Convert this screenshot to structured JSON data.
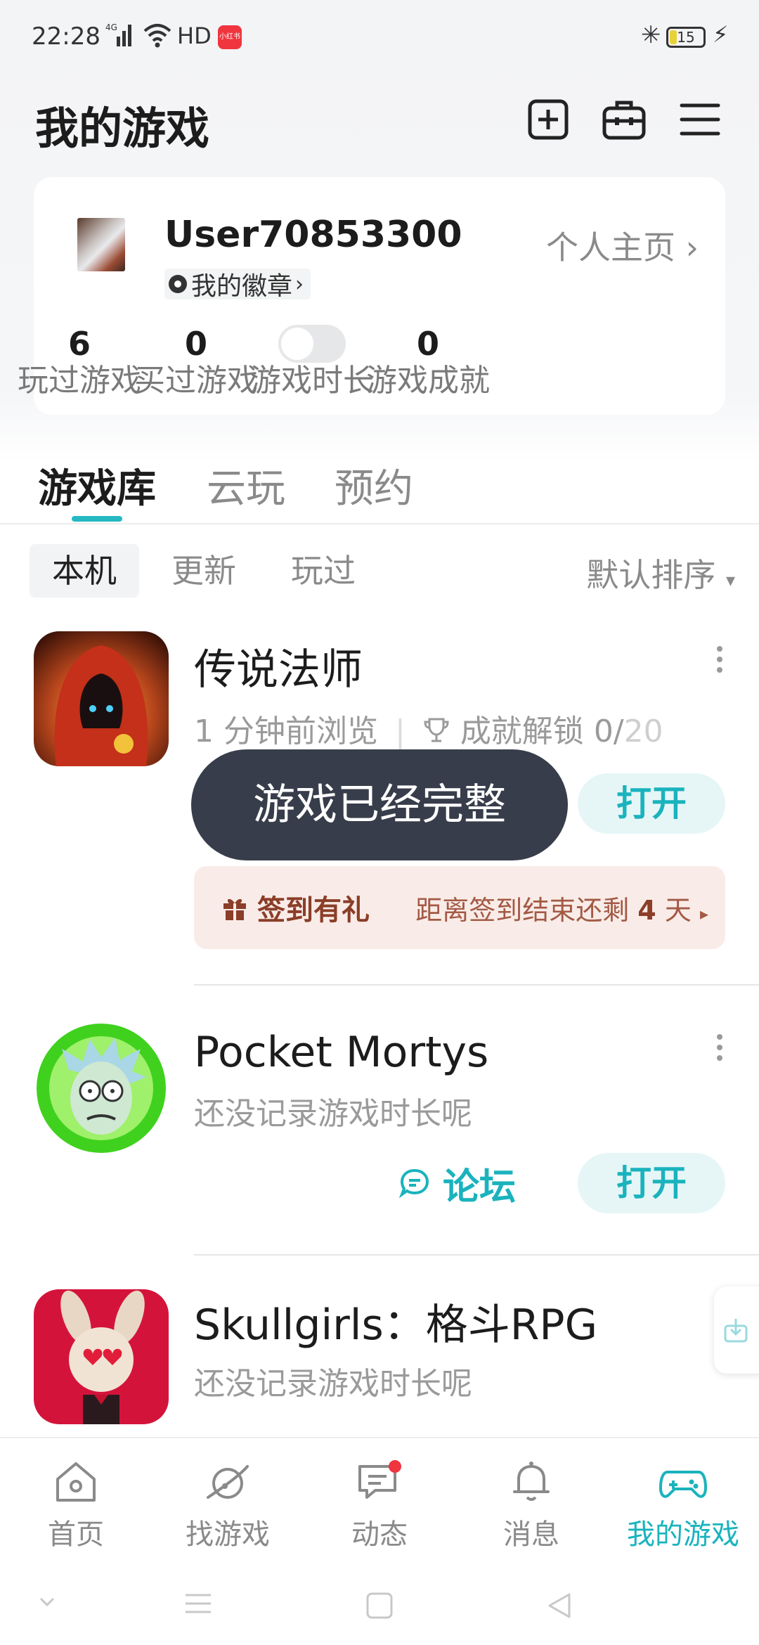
{
  "status_bar": {
    "time": "22:28",
    "network": "4G",
    "hd": "HD",
    "app_badge": "小红书",
    "battery": "15"
  },
  "header": {
    "title": "我的游戏",
    "icons": [
      "add-square-icon",
      "toolbox-icon",
      "menu-icon"
    ]
  },
  "profile": {
    "username": "User70853300",
    "badge_label": "我的徽章",
    "homepage_link": "个人主页",
    "stats": [
      {
        "value": "6",
        "label": "玩过游戏"
      },
      {
        "value": "0",
        "label": "买过游戏"
      },
      {
        "value": "",
        "label": "游戏时长",
        "toggle_on": false
      },
      {
        "value": "0",
        "label": "游戏成就"
      }
    ]
  },
  "tabs": [
    {
      "label": "游戏库",
      "active": true
    },
    {
      "label": "云玩",
      "active": false
    },
    {
      "label": "预约",
      "active": false
    }
  ],
  "filters": [
    {
      "label": "本机",
      "active": true
    },
    {
      "label": "更新",
      "active": false
    },
    {
      "label": "玩过",
      "active": false
    }
  ],
  "sort_label": "默认排序",
  "games": [
    {
      "title": "传说法师",
      "recent": "1 分钟前浏览",
      "achievement_label": "成就解锁",
      "achievement_done": "0/",
      "achievement_total": "20",
      "open_label": "打开",
      "gift": {
        "title": "签到有礼",
        "text_prefix": "距离签到结束还剩",
        "days": "4",
        "days_unit": "天"
      }
    },
    {
      "title": "Pocket Mortys",
      "subtitle": "还没记录游戏时长呢",
      "forum_label": "论坛",
      "open_label": "打开"
    },
    {
      "title": "Skullgirls：格斗RPG",
      "subtitle": "还没记录游戏时长呢"
    }
  ],
  "toast": "游戏已经完整",
  "bottom_nav": [
    {
      "label": "首页",
      "icon": "home-icon",
      "active": false
    },
    {
      "label": "找游戏",
      "icon": "planet-icon",
      "active": false
    },
    {
      "label": "动态",
      "icon": "chat-icon",
      "active": false,
      "dot": true
    },
    {
      "label": "消息",
      "icon": "bell-icon",
      "active": false
    },
    {
      "label": "我的游戏",
      "icon": "gamepad-icon",
      "active": true
    }
  ],
  "colors": {
    "accent": "#1ab3bd",
    "toast_bg": "#373d4a",
    "gift_bg": "#f9ece8",
    "gift_text": "#8b3e28",
    "notification_dot": "#f0353e"
  }
}
